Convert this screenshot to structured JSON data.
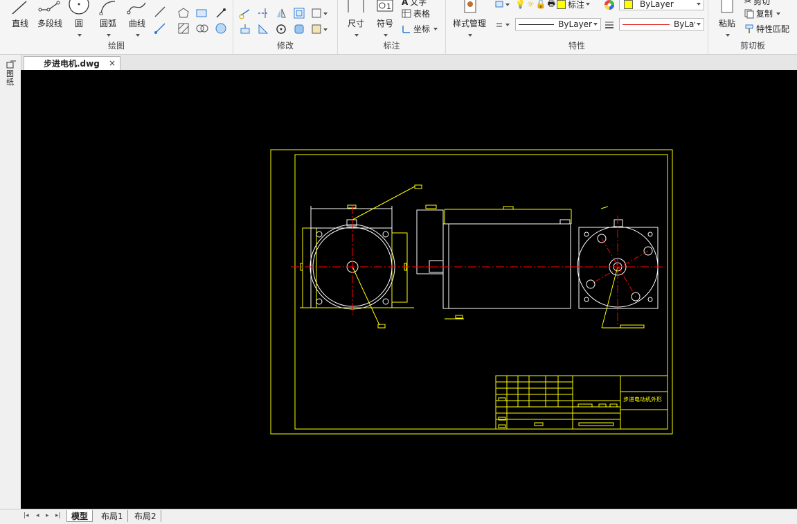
{
  "ribbon": {
    "draw": {
      "label": "绘图",
      "line": "直线",
      "polyline": "多段线",
      "circle": "圆",
      "arc": "圆弧",
      "curve": "曲线"
    },
    "modify": {
      "label": "修改"
    },
    "annotate": {
      "label": "标注",
      "dimension": "尺寸",
      "symbol": "符号",
      "text": "文字",
      "table": "表格",
      "coordinate": "坐标"
    },
    "properties": {
      "label": "特性",
      "style_manager": "样式管理",
      "layer_name": "标注",
      "color_value": "ByLayer",
      "linetype_value": "ByLayer",
      "lineweight_value": "ByLayer"
    },
    "clipboard": {
      "label": "剪切板",
      "paste": "粘贴",
      "cut": "剪切",
      "copy": "复制",
      "match_properties": "特性匹配"
    }
  },
  "document": {
    "tab_title": "步进电机.dwg",
    "close_glyph": "×"
  },
  "sidebar": {
    "panel_label": "图纸"
  },
  "drawing": {
    "title_block_text": "步进电动机外形"
  },
  "layout_tabs": [
    "模型",
    "布局1",
    "布局2"
  ],
  "nav": [
    "|◂",
    "◂",
    "▸",
    "▸|"
  ],
  "colors": {
    "accent_yellow": "#ffff00",
    "centerline_red": "#ff0000",
    "drawing_white": "#ffffff",
    "canvas_bg": "#000000"
  }
}
